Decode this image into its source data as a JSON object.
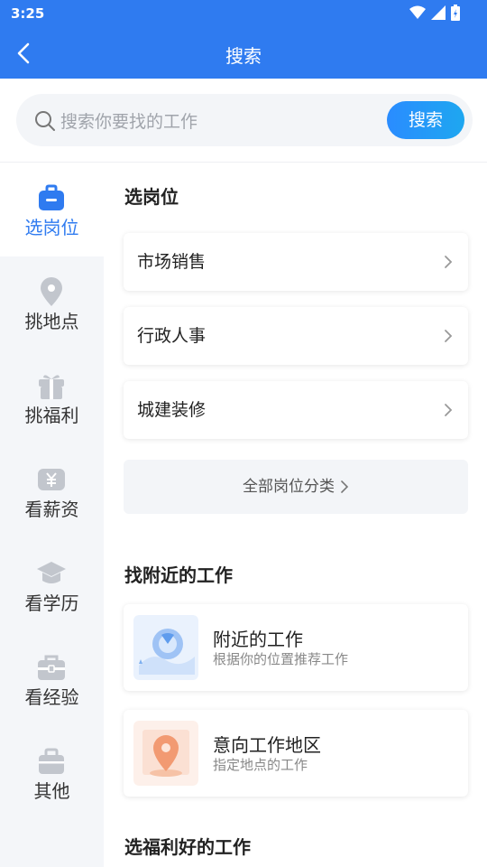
{
  "status_bar": {
    "time": "3:25"
  },
  "nav": {
    "title": "搜索"
  },
  "search": {
    "placeholder": "搜索你要找的工作",
    "button": "搜索"
  },
  "sidebar": {
    "items": [
      {
        "label": "选岗位",
        "icon": "briefcase-icon",
        "active": true
      },
      {
        "label": "挑地点",
        "icon": "location-pin-icon",
        "active": false
      },
      {
        "label": "挑福利",
        "icon": "gift-icon",
        "active": false
      },
      {
        "label": "看薪资",
        "icon": "yen-icon",
        "active": false
      },
      {
        "label": "看学历",
        "icon": "graduation-cap-icon",
        "active": false
      },
      {
        "label": "看经验",
        "icon": "toolbox-icon",
        "active": false
      },
      {
        "label": "其他",
        "icon": "bag-icon",
        "active": false
      }
    ]
  },
  "main": {
    "section_positions": {
      "title": "选岗位",
      "items": [
        {
          "label": "市场销售"
        },
        {
          "label": "行政人事"
        },
        {
          "label": "城建装修"
        }
      ],
      "all_label": "全部岗位分类"
    },
    "section_nearby": {
      "title": "找附近的工作",
      "cards": [
        {
          "title": "附近的工作",
          "subtitle": "根据你的位置推荐工作",
          "icon": "nearby-map-icon"
        },
        {
          "title": "意向工作地区",
          "subtitle": "指定地点的工作",
          "icon": "map-pin-icon"
        }
      ]
    },
    "section_benefits": {
      "title": "选福利好的工作"
    }
  },
  "colors": {
    "primary": "#2f7bf0",
    "sidebar_bg": "#f4f6f9",
    "search_button": "#1e9af5"
  }
}
